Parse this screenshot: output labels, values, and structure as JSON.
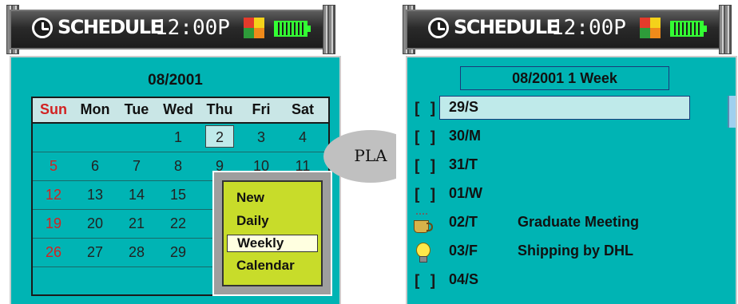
{
  "header": {
    "app_title": "SCHEDULE",
    "time": "12:00P",
    "icons": [
      "clock-icon",
      "status-icon",
      "battery-icon"
    ]
  },
  "calendar": {
    "title": "08/2001",
    "weekdays": [
      "Sun",
      "Mon",
      "Tue",
      "Wed",
      "Thu",
      "Fri",
      "Sat"
    ],
    "weeks": [
      [
        "",
        "",
        "",
        "1",
        "2",
        "3",
        "4"
      ],
      [
        "5",
        "6",
        "7",
        "8",
        "9",
        "10",
        "11"
      ],
      [
        "12",
        "13",
        "14",
        "15",
        "",
        "",
        ""
      ],
      [
        "19",
        "20",
        "21",
        "22",
        "",
        "",
        ""
      ],
      [
        "26",
        "27",
        "28",
        "29",
        "",
        "",
        ""
      ],
      [
        "",
        "",
        "",
        "",
        "",
        "",
        ""
      ]
    ],
    "selected_day": "2",
    "popup_menu": {
      "items": [
        "New",
        "Daily",
        "Weekly",
        "Calendar"
      ],
      "selected": "Weekly"
    }
  },
  "connector": {
    "label": "PLA"
  },
  "weekly": {
    "title": "08/2001 1 Week",
    "rows": [
      {
        "icon": "checkbox-empty-icon",
        "date": "29/S",
        "event": ""
      },
      {
        "icon": "checkbox-empty-icon",
        "date": "30/M",
        "event": ""
      },
      {
        "icon": "checkbox-empty-icon",
        "date": "31/T",
        "event": ""
      },
      {
        "icon": "checkbox-empty-icon",
        "date": "01/W",
        "event": ""
      },
      {
        "icon": "coffee-cup-icon",
        "date": "02/T",
        "event": "Graduate Meeting"
      },
      {
        "icon": "light-bulb-icon",
        "date": "03/F",
        "event": "Shipping by DHL"
      },
      {
        "icon": "checkbox-empty-icon",
        "date": "04/S",
        "event": ""
      }
    ],
    "selected_row": "29/S"
  },
  "colors": {
    "content_bg": "#00b4b4",
    "titlebar_bg": "#1c1c1c",
    "sunday": "#d22222",
    "menu_bg": "#c8dc2a",
    "battery": "#33ff33"
  }
}
